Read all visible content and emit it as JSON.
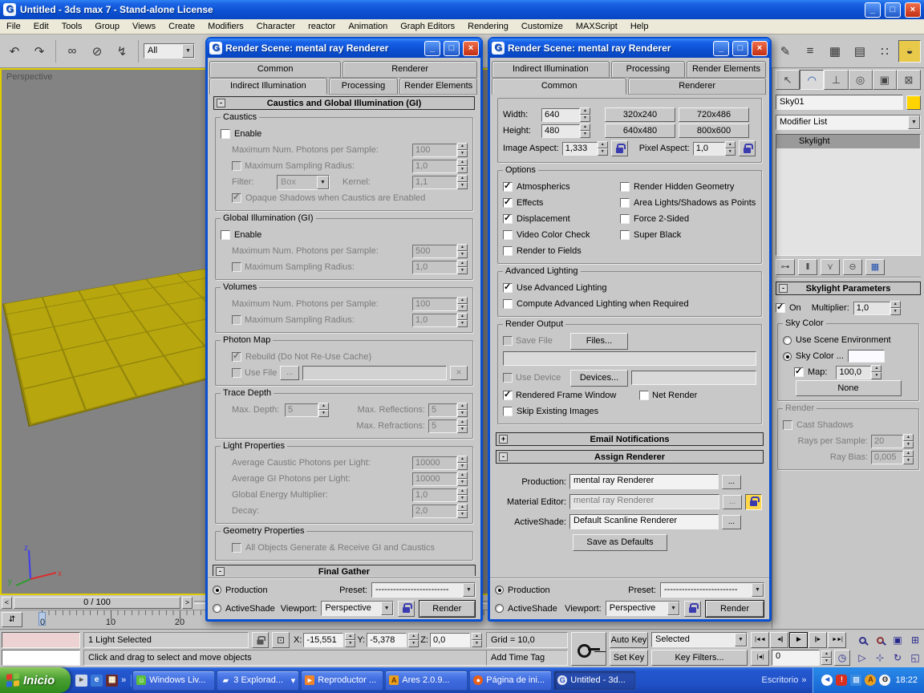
{
  "window": {
    "title": "Untitled - 3ds max 7  - Stand-alone License",
    "menu": [
      "File",
      "Edit",
      "Tools",
      "Group",
      "Views",
      "Create",
      "Modifiers",
      "Character",
      "reactor",
      "Animation",
      "Graph Editors",
      "Rendering",
      "Customize",
      "MAXScript",
      "Help"
    ]
  },
  "toolbar": {
    "selection_filter": "All"
  },
  "viewport": {
    "label": "Perspective",
    "axis_x": "x",
    "axis_y": "y",
    "axis_z": "z"
  },
  "time": {
    "prev": "<",
    "next": ">",
    "slider": "0 / 100",
    "ticks": [
      "0",
      "10",
      "20"
    ]
  },
  "dialog_left": {
    "title": "Render Scene: mental ray Renderer",
    "tabs_top": [
      "Common",
      "Renderer"
    ],
    "tabs_bottom": [
      "Indirect Illumination",
      "Processing",
      "Render Elements"
    ],
    "rollout_title": "Caustics and Global Illumination (GI)",
    "caustics": {
      "legend": "Caustics",
      "enable": "Enable",
      "max_photons_label": "Maximum Num. Photons per Sample:",
      "max_photons": "100",
      "radius_label": "Maximum Sampling Radius:",
      "radius": "1,0",
      "filter_label": "Filter:",
      "filter": "Box",
      "kernel_label": "Kernel:",
      "kernel": "1,1",
      "opaque_label": "Opaque Shadows when Caustics are Enabled"
    },
    "gi": {
      "legend": "Global Illumination (GI)",
      "enable": "Enable",
      "max_photons_label": "Maximum Num. Photons per Sample:",
      "max_photons": "500",
      "radius_label": "Maximum Sampling Radius:",
      "radius": "1,0"
    },
    "volumes": {
      "legend": "Volumes",
      "max_photons_label": "Maximum Num. Photons per Sample:",
      "max_photons": "100",
      "radius_label": "Maximum Sampling Radius:",
      "radius": "1,0"
    },
    "photon_map": {
      "legend": "Photon Map",
      "rebuild_label": "Rebuild (Do Not Re-Use Cache)",
      "use_file_label": "Use File",
      "browse": "..."
    },
    "trace": {
      "legend": "Trace Depth",
      "depth_label": "Max. Depth:",
      "depth": "5",
      "refl_label": "Max. Reflections:",
      "refl": "5",
      "refr_label": "Max. Refractions:",
      "refr": "5"
    },
    "light": {
      "legend": "Light Properties",
      "caustic_label": "Average Caustic Photons per Light:",
      "caustic": "10000",
      "gi_label": "Average GI Photons per Light:",
      "gi": "10000",
      "energy_label": "Global Energy Multiplier:",
      "energy": "1,0",
      "decay_label": "Decay:",
      "decay": "2,0"
    },
    "geometry": {
      "legend": "Geometry Properties",
      "all_label": "All Objects Generate & Receive GI and Caustics"
    },
    "final_gather": "Final Gather",
    "footer": {
      "production": "Production",
      "activeshade": "ActiveShade",
      "preset_label": "Preset:",
      "preset_value": "-------------------------",
      "viewport_label": "Viewport:",
      "viewport_value": "Perspective",
      "render": "Render"
    }
  },
  "dialog_right": {
    "title": "Render Scene: mental ray Renderer",
    "tabs_top": [
      "Indirect Illumination",
      "Processing",
      "Render Elements"
    ],
    "tabs_bottom": [
      "Common",
      "Renderer"
    ],
    "size": {
      "width_label": "Width:",
      "width": "640",
      "height_label": "Height:",
      "height": "480",
      "presets": [
        "320x240",
        "720x486",
        "640x480",
        "800x600"
      ],
      "image_aspect_label": "Image Aspect:",
      "image_aspect": "1,333",
      "pixel_aspect_label": "Pixel Aspect:",
      "pixel_aspect": "1,0"
    },
    "options": {
      "legend": "Options",
      "col1": [
        "Atmospherics",
        "Effects",
        "Displacement",
        "Video Color Check",
        "Render to Fields"
      ],
      "col2": [
        "Render Hidden Geometry",
        "Area Lights/Shadows as Points",
        "Force 2-Sided",
        "Super Black"
      ]
    },
    "advanced": {
      "legend": "Advanced Lighting",
      "use_label": "Use Advanced Lighting",
      "compute_label": "Compute Advanced Lighting when Required"
    },
    "output": {
      "legend": "Render Output",
      "save_label": "Save File",
      "files_btn": "Files...",
      "device_label": "Use Device",
      "devices_btn": "Devices...",
      "rfw_label": "Rendered Frame Window",
      "net_label": "Net Render",
      "skip_label": "Skip Existing Images"
    },
    "email_title": "Email Notifications",
    "assign": {
      "title": "Assign Renderer",
      "production_label": "Production:",
      "production": "mental ray Renderer",
      "material_label": "Material Editor:",
      "material": "mental ray Renderer",
      "activeshade_label": "ActiveShade:",
      "activeshade": "Default Scanline Renderer",
      "browse": "...",
      "save_defaults": "Save as Defaults"
    },
    "footer": {
      "production": "Production",
      "activeshade": "ActiveShade",
      "preset_label": "Preset:",
      "preset_value": "-------------------------",
      "viewport_label": "Viewport:",
      "viewport_value": "Perspective",
      "render": "Render"
    }
  },
  "command_panel": {
    "object_name": "Sky01",
    "modifier_list": "Modifier List",
    "stack_item": "Skylight",
    "skylight": {
      "title": "Skylight Parameters",
      "on_label": "On",
      "multiplier_label": "Multiplier:",
      "multiplier": "1,0",
      "sky_color": {
        "legend": "Sky Color",
        "use_env": "Use Scene Environment",
        "sky_color": "Sky Color ...",
        "map_label": "Map:",
        "map": "100,0",
        "none_btn": "None"
      },
      "render": {
        "legend": "Render",
        "cast_label": "Cast Shadows",
        "rays_label": "Rays per Sample:",
        "rays": "20",
        "bias_label": "Ray Bias:",
        "bias": "0,005"
      }
    }
  },
  "statusbar": {
    "selection": "1 Light Selected",
    "x_label": "X:",
    "x": "-15,551",
    "y_label": "Y:",
    "y": "-5,378",
    "z_label": "Z:",
    "z": "0,0",
    "grid": "Grid = 10,0",
    "prompt": "Click and drag to select and move objects",
    "add_time_tag": "Add Time Tag",
    "auto_key": "Auto Key",
    "set_key": "Set Key",
    "key_selection": "Selected",
    "key_filters": "Key Filters...",
    "frame": "0"
  },
  "taskbar": {
    "start": "Inicio",
    "buttons": [
      "Windows Liv...",
      "3 Explorad...",
      "Reproductor ...",
      "Ares 2.0.9...",
      "Página de ini...",
      "Untitled - 3d..."
    ],
    "desktop": "Escritorio",
    "clock": "18:22",
    "chevron": "»"
  },
  "icons": {
    "undo": "↶",
    "redo": "↷",
    "link": "∞",
    "unlink": "⊘",
    "bind": "↯",
    "dropdown": "▼",
    "caret": "▾",
    "minimize": "_",
    "maximize": "□",
    "close": "×",
    "eraser": "✎",
    "layers": "≡",
    "curve_editor": "▦",
    "schematic": "▤",
    "material": "∷",
    "render_teapot": "◒",
    "tab_create": "↖",
    "tab_modify": "◠",
    "tab_hierarchy": "⊥",
    "tab_motion": "◎",
    "tab_display": "▣",
    "tab_utilities": "⊠",
    "pin": "⊶",
    "show_end": "‖",
    "make_unique": "⋎",
    "remove": "⊖",
    "configure": "▦",
    "go_start": "|◄◄",
    "prev_frame": "◄||",
    "play": "►",
    "next_frame": "||►",
    "go_end": "►►|",
    "key_step": "|◄|",
    "time_config": "◷",
    "zoom_extents": "▣",
    "zoom_extents_all": "⊞",
    "fov": "▷",
    "pan": "⊹",
    "arc_rotate": "↻",
    "max_toggle": "◱",
    "trackbar_toggle": "⇵",
    "tray_chevron": "◀",
    "abs_mode": "⊡",
    "clear": "×",
    "logo": "G"
  }
}
